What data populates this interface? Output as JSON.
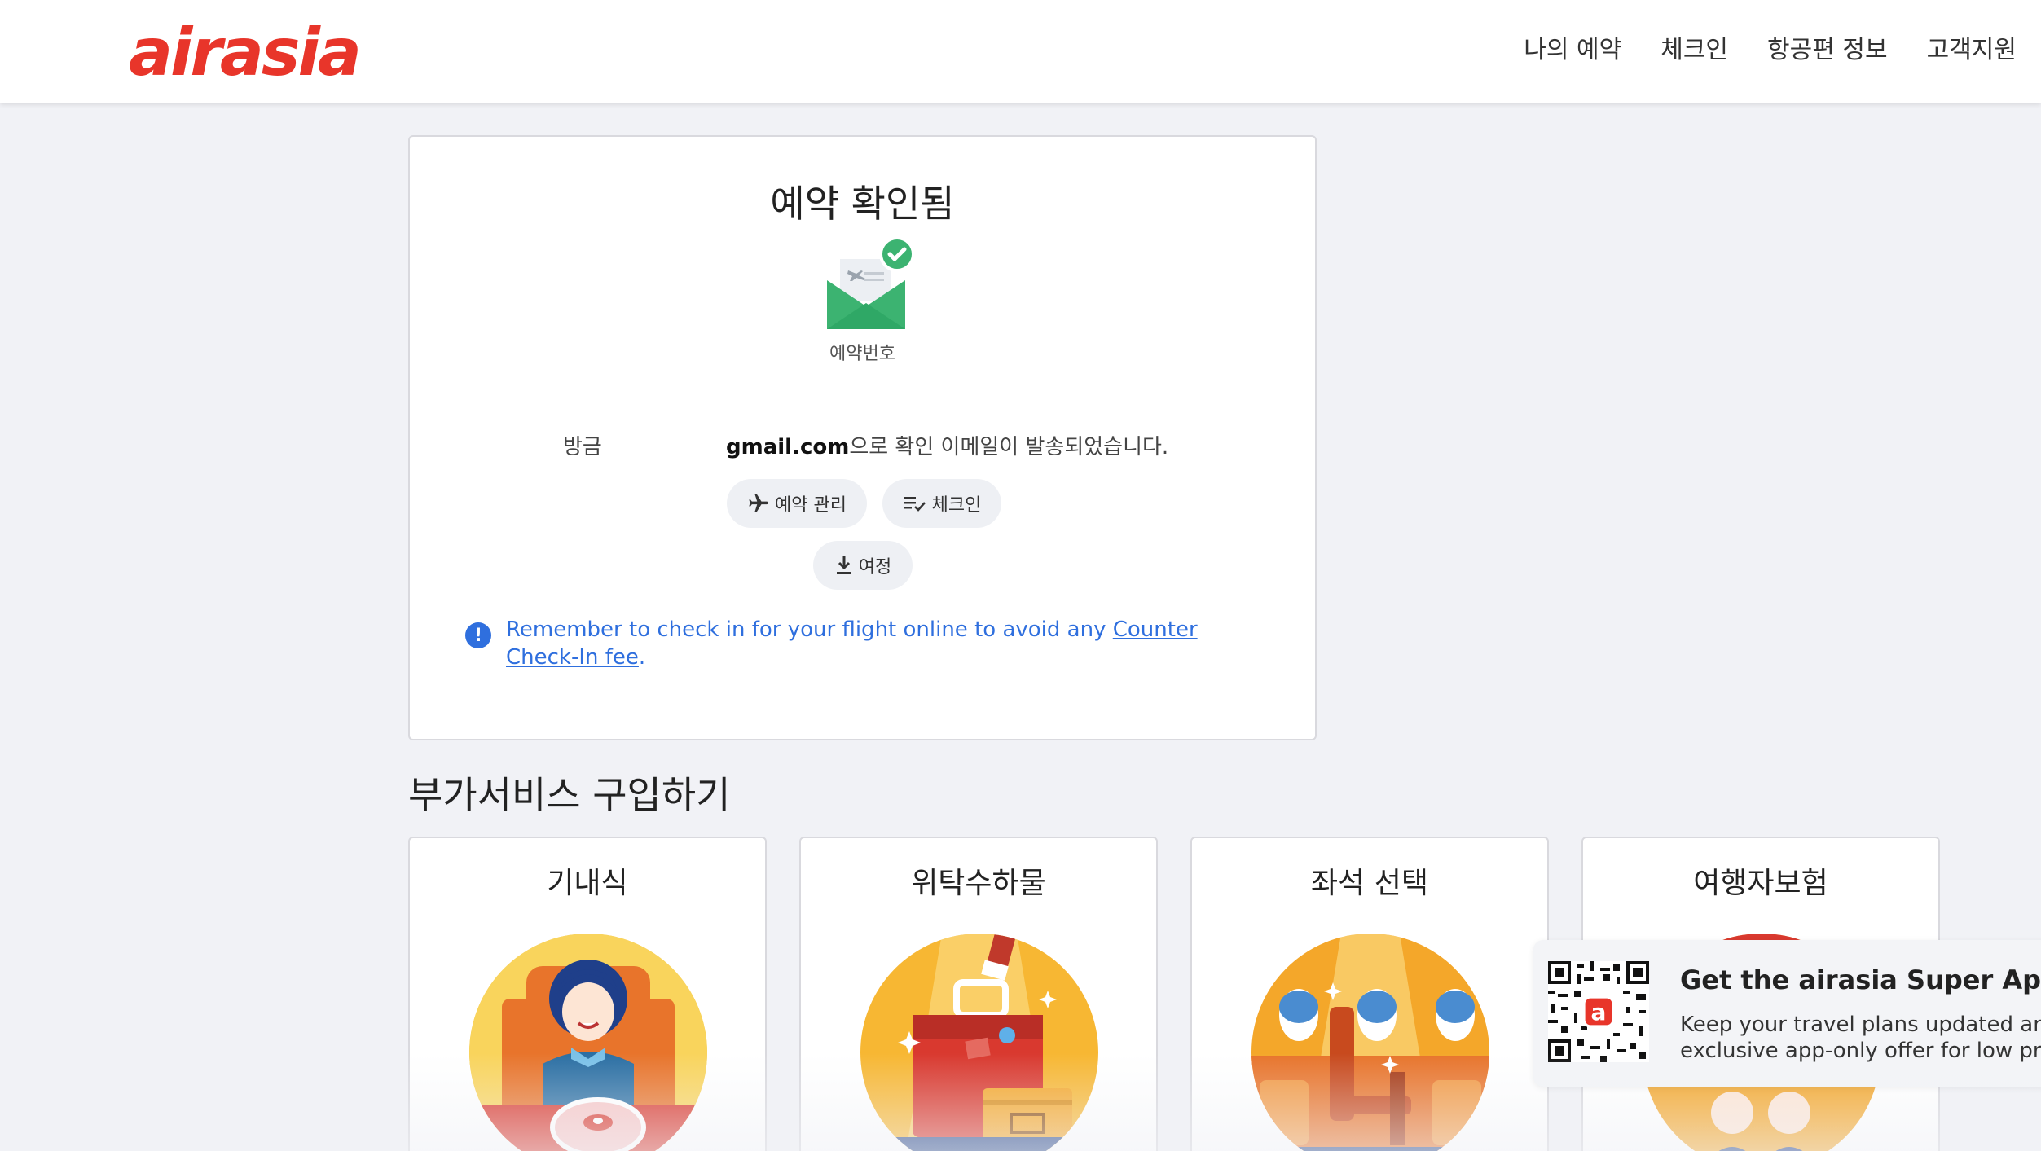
{
  "header": {
    "logo": "airasia",
    "nav": [
      "나의 예약",
      "체크인",
      "항공편 정보",
      "고객지원"
    ]
  },
  "confirmation": {
    "title": "예약 확인됨",
    "booking_number_label": "예약번호",
    "recipient_name": "방금",
    "email_bold": "gmail.com",
    "email_suffix": "으로 확인 이메일이 발송되었습니다.",
    "buttons": {
      "manage": "예약 관리",
      "checkin": "체크인",
      "itinerary": "여정"
    },
    "notice": {
      "text": "Remember to check in for your flight online to avoid any ",
      "link": "Counter Check-In fee",
      "end": "."
    }
  },
  "addons": {
    "title": "부가서비스 구입하기",
    "items": [
      "기내식",
      "위탁수하물",
      "좌석 선택",
      "여행자보험"
    ]
  },
  "promo": {
    "title": "Get the airasia Super App",
    "text": "Keep your travel plans updated and get exclusive app-only offer for low prices"
  },
  "colors": {
    "brand": "#e8352a",
    "link": "#2f6fde",
    "success": "#3cb371"
  }
}
